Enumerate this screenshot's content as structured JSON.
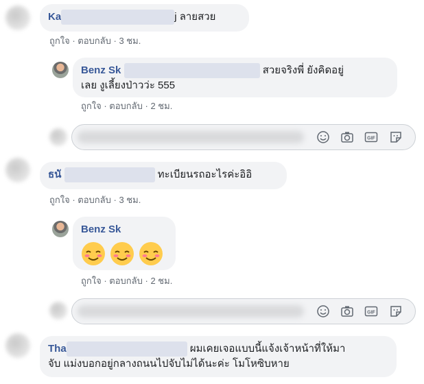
{
  "colors": {
    "bubble": "#f2f3f5",
    "name": "#385898",
    "meta": "#606770"
  },
  "comments": [
    {
      "name": "Ka",
      "text": "j ลายสวย",
      "actions": {
        "like": "ถูกใจ",
        "reply": "ตอบกลับ",
        "time": "3 ชม."
      }
    },
    {
      "name": "Benz Sk",
      "text": "สวยจริงพี่ ยังคิดอยู่",
      "text2": "เลย งูเลี้ยงป่าวว่ะ 555",
      "actions": {
        "like": "ถูกใจ",
        "reply": "ตอบกลับ",
        "time": "2 ชม."
      }
    },
    {
      "name": "ธนั",
      "text": "ทะเบียนรถอะไรค่ะอิอิ",
      "actions": {
        "like": "ถูกใจ",
        "reply": "ตอบกลับ",
        "time": "3 ชม."
      }
    },
    {
      "name": "Benz Sk",
      "emoji": [
        "smiling-face-icon",
        "smiling-face-icon",
        "smiling-face-icon"
      ],
      "actions": {
        "like": "ถูกใจ",
        "reply": "ตอบกลับ",
        "time": "2 ชม."
      }
    },
    {
      "name": "Tha",
      "text": "ผมเคยเจอแบบนี้แจ้งเจ้าหน้าที่ให้มา",
      "text2": "จับ แม่งบอกอยู่กลางถนนไปจับไม่ได้นะค่ะ โมโหซิบหาย"
    }
  ],
  "composer_icons": [
    "emoji-icon",
    "camera-icon",
    "gif-icon",
    "sticker-icon"
  ]
}
